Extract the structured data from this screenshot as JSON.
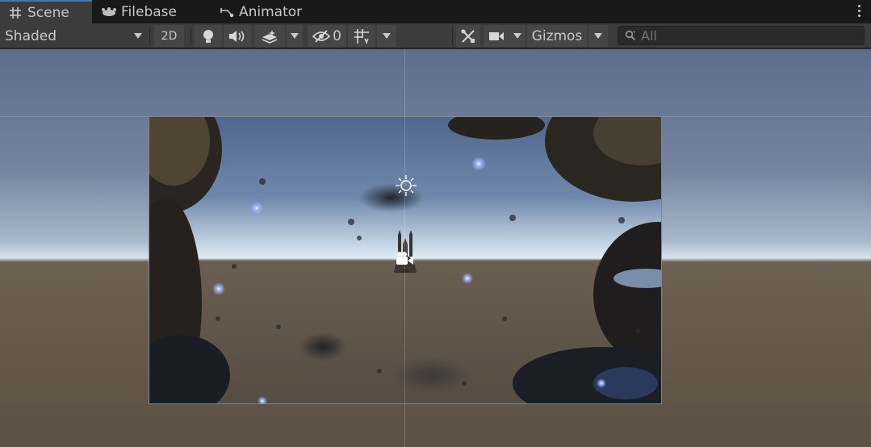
{
  "tabs": [
    {
      "label": "Scene",
      "icon": "grid-icon",
      "active": true
    },
    {
      "label": "Filebase",
      "icon": "filebase-icon",
      "active": false
    },
    {
      "label": "Animator",
      "icon": "animator-icon",
      "active": false
    }
  ],
  "toolbar": {
    "shading_mode": "Shaded",
    "mode_2d": "2D",
    "hidden_count": "0",
    "gizmos_label": "Gizmos"
  },
  "search": {
    "placeholder": "All"
  },
  "colors": {
    "accent": "#3a79bb",
    "toolbar_bg": "#3c3c3c",
    "tabbar_bg": "#191919"
  }
}
